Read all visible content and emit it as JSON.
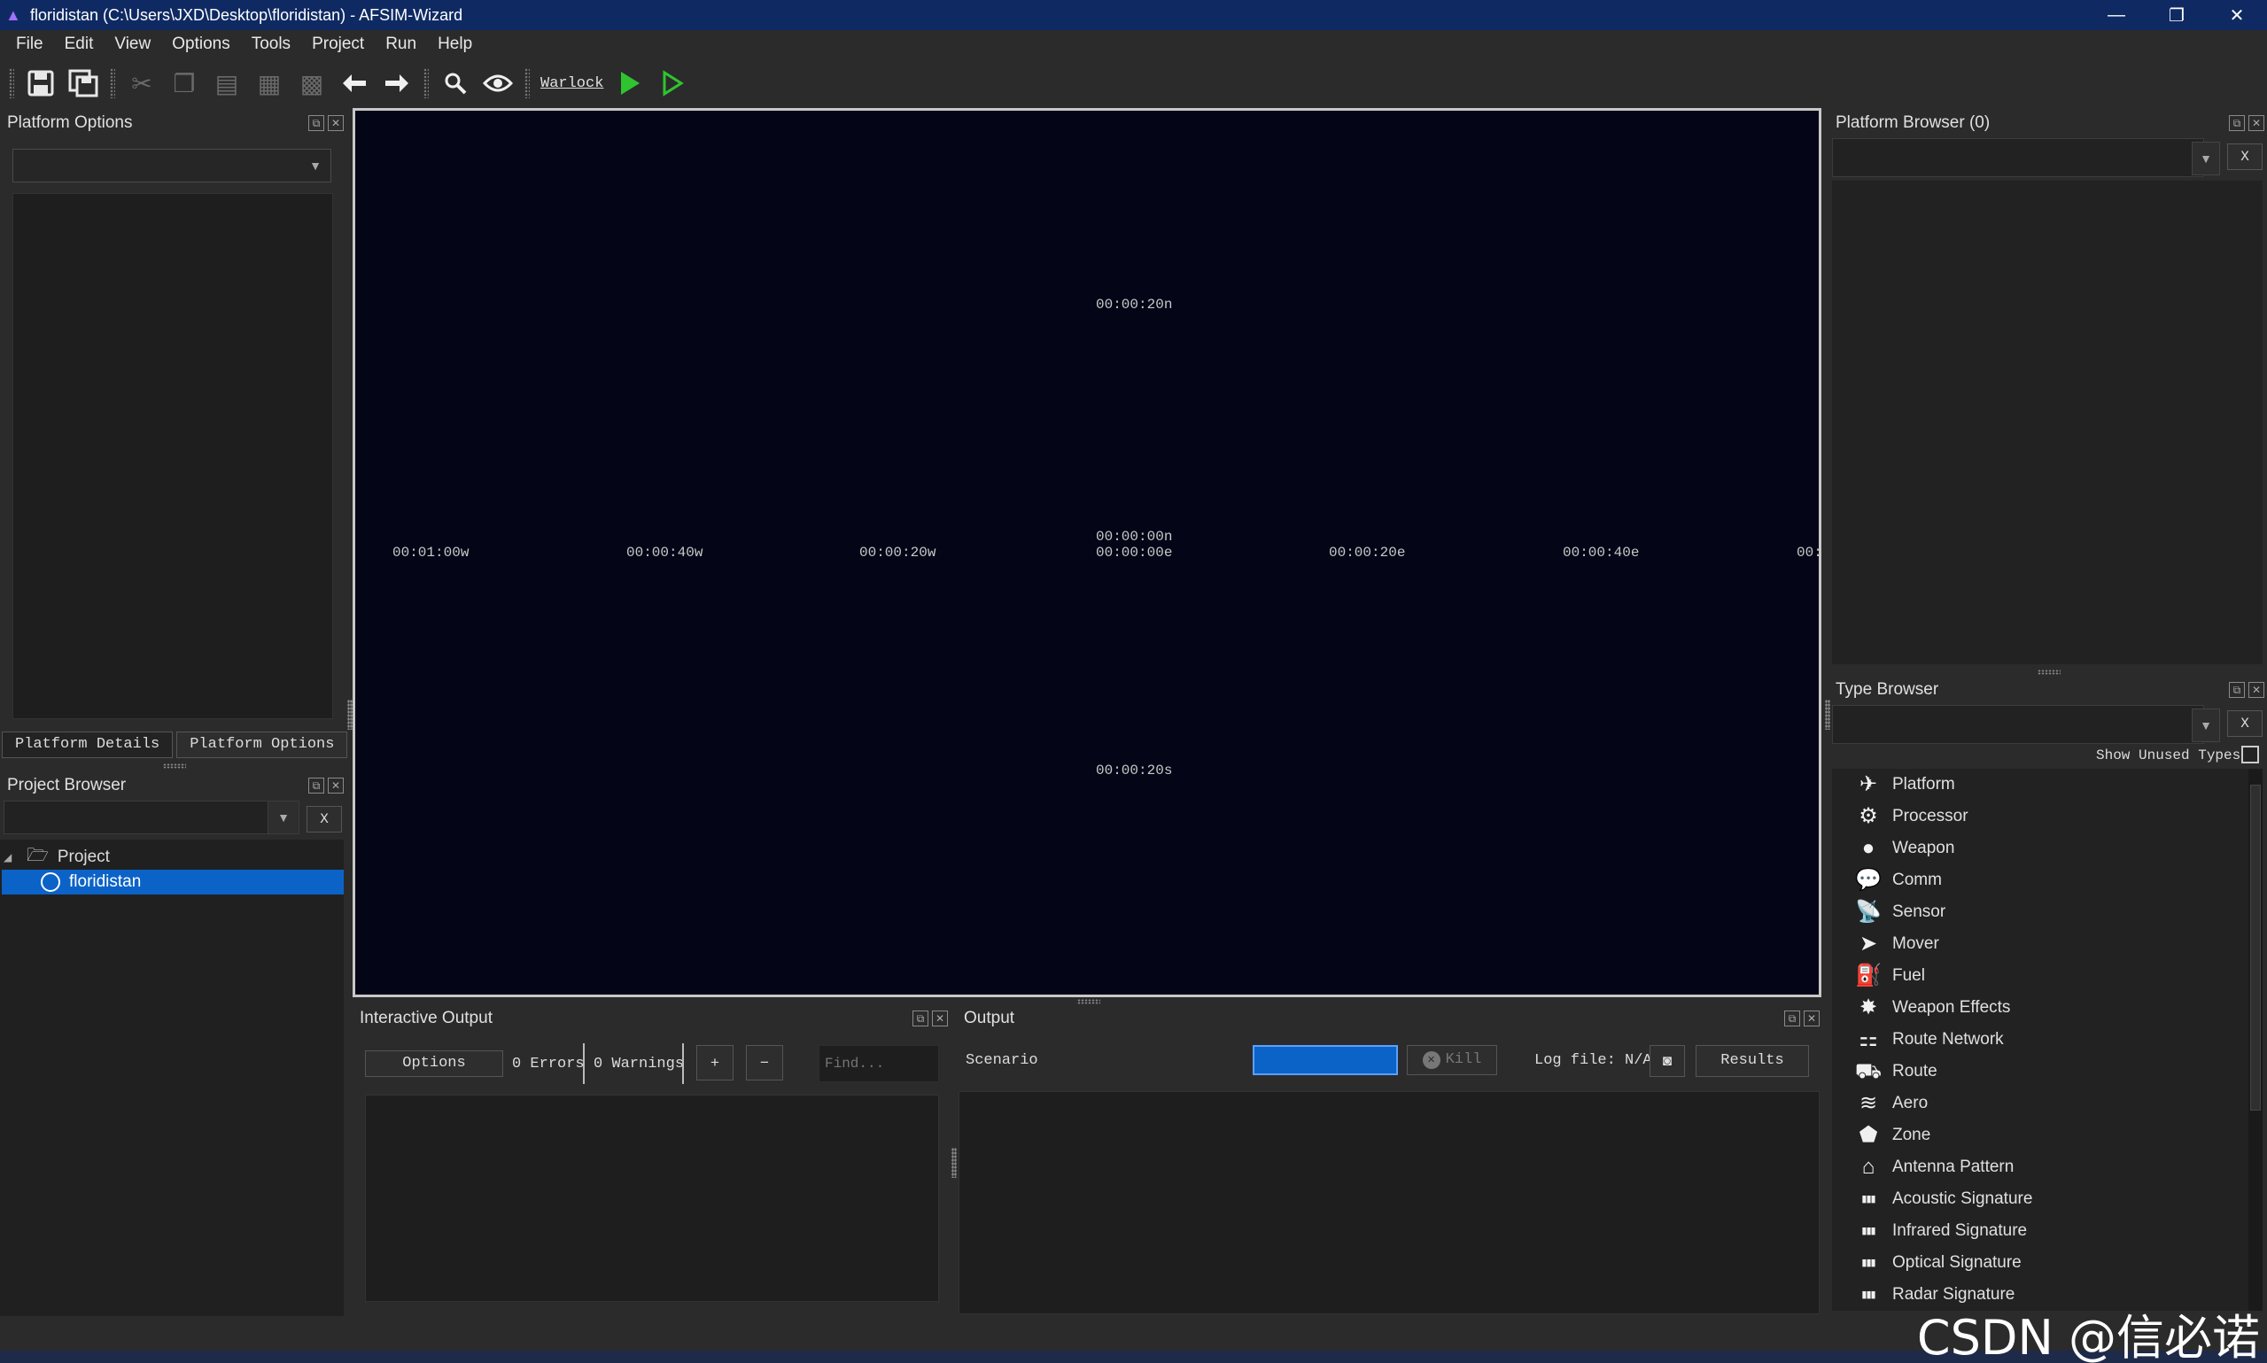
{
  "window": {
    "title": "floridistan (C:\\Users\\JXD\\Desktop\\floridistan) - AFSIM-Wizard",
    "minimize": "—",
    "restore": "❐",
    "close": "✕"
  },
  "menu": [
    "File",
    "Edit",
    "View",
    "Options",
    "Tools",
    "Project",
    "Run",
    "Help"
  ],
  "toolbar": {
    "warlock_link": "Warlock",
    "icons": [
      "save-icon",
      "save-all-icon",
      "cut-icon",
      "copy-icon",
      "paste-icon",
      "clipboard-icon",
      "grid-icon",
      "back-arrow-icon",
      "forward-arrow-icon",
      "search-icon",
      "eye-icon",
      "run-icon",
      "run-outline-icon"
    ]
  },
  "left_panel": {
    "platform_options_title": "Platform Options",
    "tabs": [
      "Platform Details",
      "Platform Options"
    ],
    "project_browser_title": "Project Browser",
    "clear_label": "X",
    "tree": {
      "root": "Project",
      "child": "floridistan"
    }
  },
  "map": {
    "labels": {
      "n20": "00:00:20n",
      "w100": "00:01:00w",
      "w40": "00:00:40w",
      "w20": "00:00:20w",
      "origin": "00:00:00n\n00:00:00e",
      "e20": "00:00:20e",
      "e40": "00:00:40e",
      "edge": "00:",
      "s20": "00:00:20s"
    }
  },
  "interactive_output": {
    "title": "Interactive Output",
    "options_label": "Options",
    "errors": "0 Errors",
    "warnings": "0 Warnings",
    "plus": "+",
    "minus": "−",
    "find_placeholder": "Find..."
  },
  "output": {
    "title": "Output",
    "scenario": "Scenario",
    "kill_label": "Kill",
    "log_file": "Log file: N/A",
    "results_label": "Results"
  },
  "right_panel": {
    "platform_browser_title": "Platform Browser (0)",
    "type_browser_title": "Type Browser",
    "clear_label": "X",
    "show_unused_types": "Show Unused Types",
    "types": [
      {
        "label": "Platform",
        "icon": "plane-icon",
        "glyph": "✈"
      },
      {
        "label": "Processor",
        "icon": "gears-icon",
        "glyph": "⚙"
      },
      {
        "label": "Weapon",
        "icon": "bomb-icon",
        "glyph": "●"
      },
      {
        "label": "Comm",
        "icon": "speech-bubble-icon",
        "glyph": "💬"
      },
      {
        "label": "Sensor",
        "icon": "satellite-dish-icon",
        "glyph": "📡"
      },
      {
        "label": "Mover",
        "icon": "mover-icon",
        "glyph": "➤"
      },
      {
        "label": "Fuel",
        "icon": "fuel-icon",
        "glyph": "⛽"
      },
      {
        "label": "Weapon Effects",
        "icon": "explosion-icon",
        "glyph": "✸"
      },
      {
        "label": "Route Network",
        "icon": "network-icon",
        "glyph": "⚏"
      },
      {
        "label": "Route",
        "icon": "route-icon",
        "glyph": "⛟"
      },
      {
        "label": "Aero",
        "icon": "wing-icon",
        "glyph": "≋"
      },
      {
        "label": "Zone",
        "icon": "pentagon-icon",
        "glyph": "⬟"
      },
      {
        "label": "Antenna Pattern",
        "icon": "house-icon",
        "glyph": "⌂"
      },
      {
        "label": "Acoustic Signature",
        "icon": "bars-icon",
        "glyph": "▮▮▮"
      },
      {
        "label": "Infrared Signature",
        "icon": "bars-icon",
        "glyph": "▮▮▮"
      },
      {
        "label": "Optical Signature",
        "icon": "bars-icon",
        "glyph": "▮▮▮"
      },
      {
        "label": "Radar Signature",
        "icon": "bars-icon",
        "glyph": "▮▮▮"
      }
    ]
  },
  "watermark": "CSDN @信必诺"
}
